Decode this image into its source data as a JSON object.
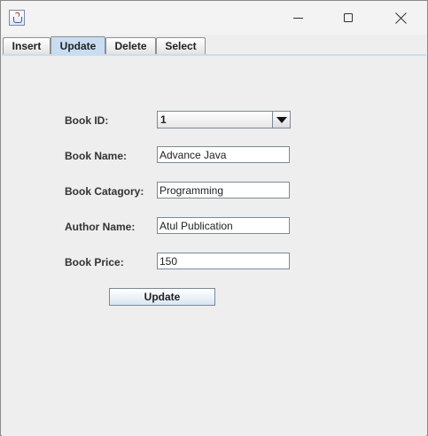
{
  "tabs": [
    {
      "label": "Insert",
      "selected": false
    },
    {
      "label": "Update",
      "selected": true
    },
    {
      "label": "Delete",
      "selected": false
    },
    {
      "label": "Select",
      "selected": false
    }
  ],
  "form": {
    "book_id_label": "Book ID:",
    "book_id_value": "1",
    "book_name_label": "Book Name:",
    "book_name_value": "Advance Java",
    "book_category_label": "Book Catagory:",
    "book_category_value": "Programming",
    "author_name_label": "Author Name:",
    "author_name_value": "Atul Publication",
    "book_price_label": "Book Price:",
    "book_price_value": "150",
    "submit_label": "Update"
  },
  "icons": {
    "app": "java-cup-icon",
    "minimize": "minimize-icon",
    "maximize": "maximize-icon",
    "close": "close-icon",
    "dropdown": "chevron-down-icon"
  },
  "colors": {
    "selected_tab": "#c8ddf2",
    "panel_background": "#eeeeee"
  }
}
